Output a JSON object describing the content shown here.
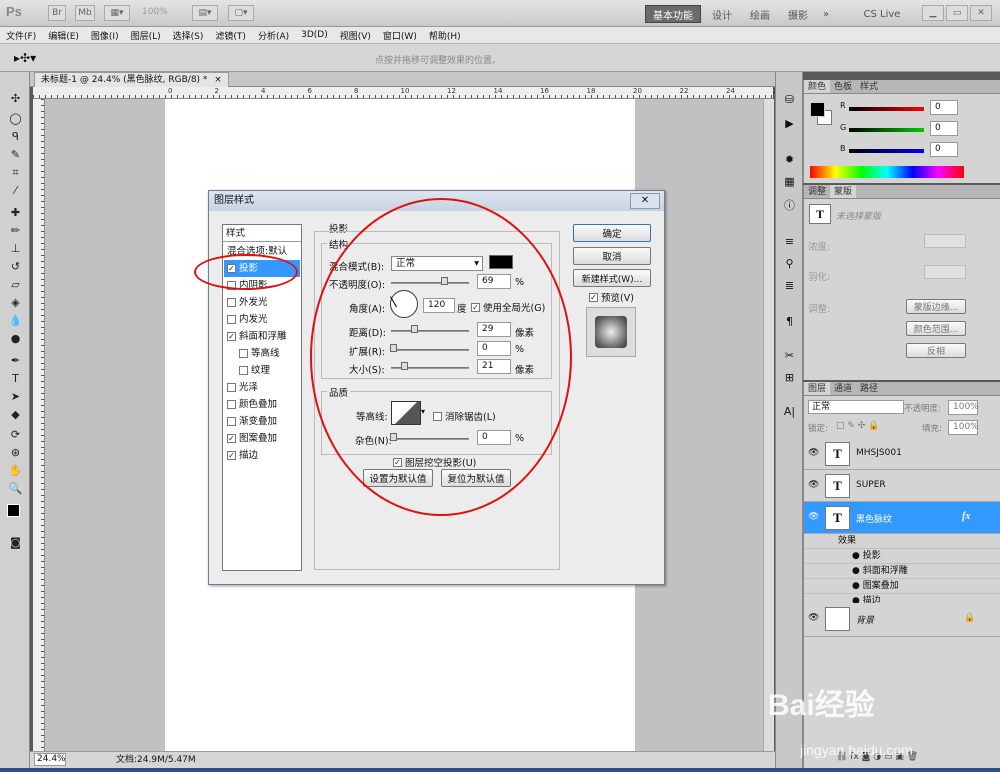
{
  "app": {
    "logo": "Ps",
    "zoom": "100%",
    "workspaces": [
      "基本功能",
      "设计",
      "绘画",
      "摄影"
    ],
    "more": "»",
    "cslive": "CS Live"
  },
  "menu": [
    "文件(F)",
    "编辑(E)",
    "图像(I)",
    "图层(L)",
    "选择(S)",
    "滤镜(T)",
    "分析(A)",
    "3D(D)",
    "视图(V)",
    "窗口(W)",
    "帮助(H)"
  ],
  "options": {
    "hint": "点按并拖移可调整效果的位置。"
  },
  "document": {
    "tab": "未标题-1 @ 24.4% (黑色脉纹, RGB/8) *",
    "close": "×"
  },
  "ruler": {
    "h": [
      "0",
      "2",
      "4",
      "6",
      "8",
      "10",
      "12",
      "14",
      "16",
      "18",
      "20",
      "22",
      "24",
      "26"
    ]
  },
  "status": {
    "zoom": "24.4%",
    "doc": "文档:24.9M/5.47M"
  },
  "dialog": {
    "title": "图层样式",
    "styles_header": "样式",
    "styles": [
      {
        "label": "混合选项:默认",
        "checkbox": false,
        "checked": false
      },
      {
        "label": "投影",
        "checkbox": true,
        "checked": true,
        "selected": true
      },
      {
        "label": "内阴影",
        "checkbox": true,
        "checked": false
      },
      {
        "label": "外发光",
        "checkbox": true,
        "checked": false
      },
      {
        "label": "内发光",
        "checkbox": true,
        "checked": false
      },
      {
        "label": "斜面和浮雕",
        "checkbox": true,
        "checked": true
      },
      {
        "label": "等高线",
        "checkbox": true,
        "checked": false,
        "indent": true
      },
      {
        "label": "纹理",
        "checkbox": true,
        "checked": false,
        "indent": true
      },
      {
        "label": "光泽",
        "checkbox": true,
        "checked": false
      },
      {
        "label": "颜色叠加",
        "checkbox": true,
        "checked": false
      },
      {
        "label": "渐变叠加",
        "checkbox": true,
        "checked": false
      },
      {
        "label": "图案叠加",
        "checkbox": true,
        "checked": true
      },
      {
        "label": "描边",
        "checkbox": true,
        "checked": true
      }
    ],
    "section": "投影",
    "structure": "结构",
    "blend_label": "混合模式(B):",
    "blend_value": "正常",
    "opacity_label": "不透明度(O):",
    "opacity": "69",
    "pct": "%",
    "angle_label": "角度(A):",
    "angle": "120",
    "deg": "度",
    "global_light": "使用全局光(G)",
    "distance_label": "距离(D):",
    "distance": "29",
    "px": "像素",
    "spread_label": "扩展(R):",
    "spread": "0",
    "size_label": "大小(S):",
    "size": "21",
    "quality": "品质",
    "contour_label": "等高线:",
    "antialias": "消除锯齿(L)",
    "noise_label": "杂色(N):",
    "noise": "0",
    "knockout": "图层挖空投影(U)",
    "make_default": "设置为默认值",
    "reset_default": "复位为默认值",
    "ok": "确定",
    "cancel": "取消",
    "new_style": "新建样式(W)...",
    "preview": "预览(V)"
  },
  "color_panel": {
    "tabs": [
      "颜色",
      "色板",
      "样式"
    ],
    "r": "0",
    "g": "0",
    "b": "0",
    "R": "R",
    "G": "G",
    "B": "B"
  },
  "adjust_panel": {
    "tabs": [
      "调整",
      "蒙版"
    ],
    "none": "未选择蒙版",
    "density": "浓度:",
    "feather": "羽化:",
    "refine": "调整:",
    "edge": "蒙版边缘...",
    "range": "颜色范围...",
    "invert": "反相"
  },
  "layers_panel": {
    "tabs": [
      "图层",
      "通道",
      "路径"
    ],
    "mode": "正常",
    "opacity_label": "不透明度:",
    "opacity": "100%",
    "lock_label": "锁定:",
    "fill_label": "填充:",
    "fill": "100%",
    "layers": [
      {
        "name": "MHSJS001",
        "thumb": "T"
      },
      {
        "name": "SUPER",
        "thumb": "T"
      },
      {
        "name": "黑色脉纹",
        "thumb": "T",
        "selected": true,
        "fx": "fx"
      }
    ],
    "effects_label": "效果",
    "effects": [
      "投影",
      "斜面和浮雕",
      "图案叠加",
      "描边"
    ],
    "background": "背景"
  },
  "watermark": {
    "main": "Bai经验",
    "sub": "jingyan.baidu.com"
  }
}
